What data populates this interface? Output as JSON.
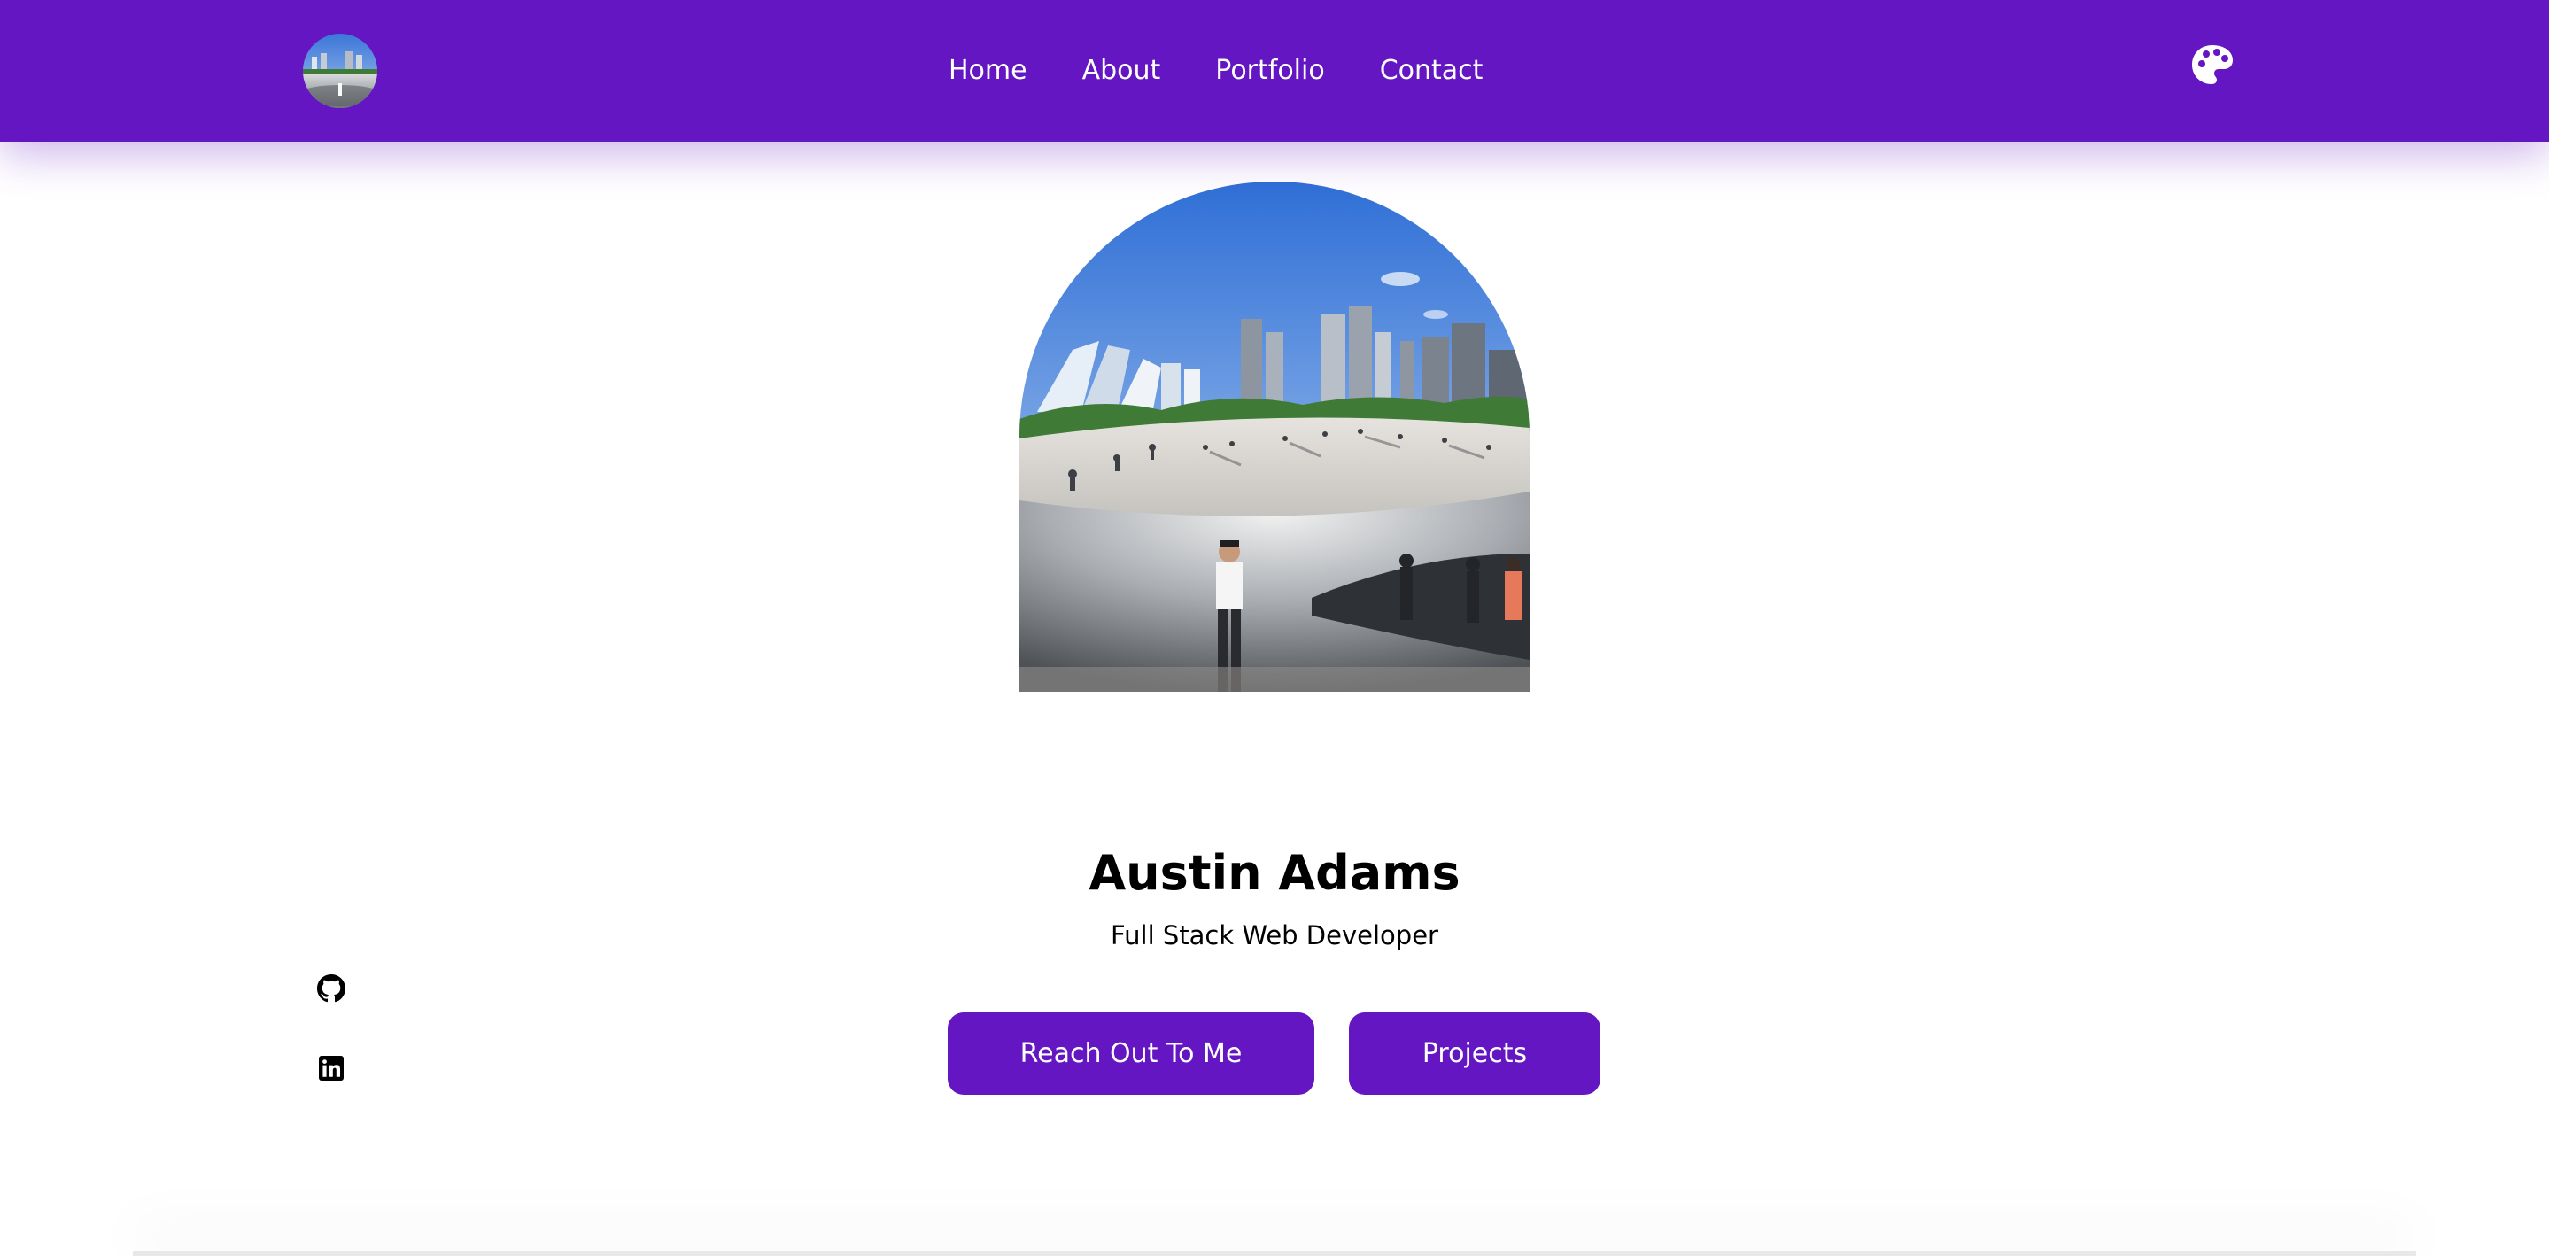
{
  "nav": {
    "logo_alt": "avatar",
    "links": [
      {
        "label": "Home"
      },
      {
        "label": "About"
      },
      {
        "label": "Portfolio"
      },
      {
        "label": "Contact"
      }
    ],
    "theme_icon": "palette-icon"
  },
  "hero": {
    "name": "Austin Adams",
    "subtitle": "Full Stack Web Developer",
    "buttons": {
      "reach_out": "Reach Out To Me",
      "projects": "Projects"
    },
    "photo": "hero-photo"
  },
  "socials": [
    {
      "icon": "github-icon"
    },
    {
      "icon": "linkedin-icon"
    }
  ],
  "colors": {
    "primary": "#6316c2",
    "text": "#000000",
    "background": "#ffffff"
  }
}
